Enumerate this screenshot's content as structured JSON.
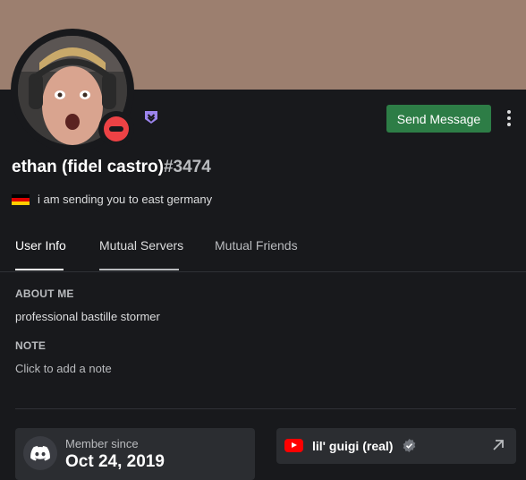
{
  "banner": {
    "color": "#9c7f6f"
  },
  "profile": {
    "name": "ethan (fidel castro)",
    "discriminator": "#3474",
    "status": "dnd",
    "status_color": "#ed4245",
    "badge_icon": "hypesquad-balance-icon",
    "custom_status": {
      "flag_icon": "germany-flag-icon",
      "text": "i am sending you to east germany"
    }
  },
  "actions": {
    "send_message": "Send Message",
    "more_icon": "more-vertical-icon",
    "accent": "#2d7d46"
  },
  "tabs": [
    {
      "label": "User Info",
      "active": true
    },
    {
      "label": "Mutual Servers",
      "active": false
    },
    {
      "label": "Mutual Friends",
      "active": false
    }
  ],
  "about": {
    "heading": "ABOUT ME",
    "text": "professional bastille stormer"
  },
  "note": {
    "heading": "NOTE",
    "placeholder": "Click to add a note"
  },
  "member_since": {
    "icon": "discord-logo-icon",
    "label": "Member since",
    "date": "Oct 24, 2019"
  },
  "connection": {
    "icon": "youtube-icon",
    "name": "lil' guigi (real)",
    "verified_icon": "verified-icon",
    "link_icon": "external-link-icon"
  }
}
